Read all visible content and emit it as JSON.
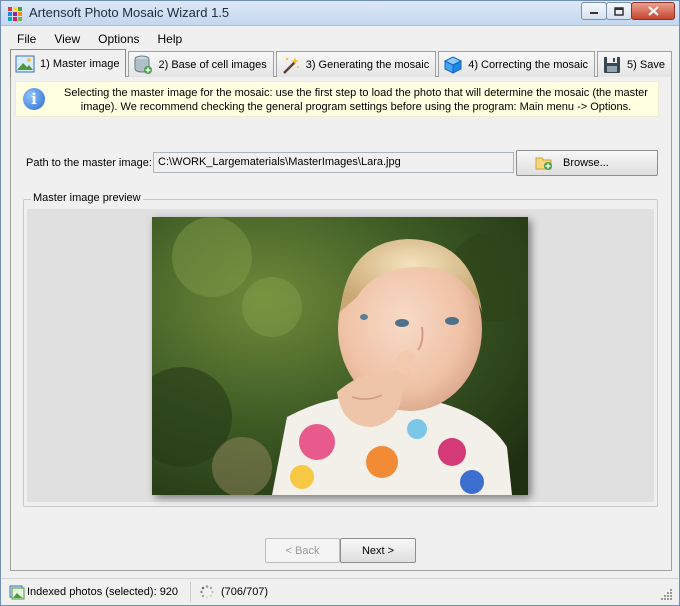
{
  "window": {
    "title": "Artensoft Photo Mosaic Wizard 1.5",
    "controls": {
      "minimize": "minimize",
      "maximize": "maximize",
      "close": "close"
    }
  },
  "menu": [
    "File",
    "View",
    "Options",
    "Help"
  ],
  "tabs": [
    {
      "label": "1) Master image",
      "icon": "image-icon",
      "active": true
    },
    {
      "label": "2) Base of cell images",
      "icon": "database-add-icon",
      "active": false
    },
    {
      "label": "3) Generating the mosaic",
      "icon": "magic-wand-icon",
      "active": false
    },
    {
      "label": "4) Correcting the mosaic",
      "icon": "cube-icon",
      "active": false
    },
    {
      "label": "5) Save",
      "icon": "floppy-disk-icon",
      "active": false
    }
  ],
  "info": {
    "line1": "Selecting the master image for the mosaic: use the first step to load the photo that will determine the mosaic (the master",
    "line2": "image). We recommend checking the general program settings before using the program: Main menu -> Options."
  },
  "path": {
    "label": "Path to the master image:",
    "value": "C:\\WORK_Largematerials\\MasterImages\\Lara.jpg",
    "browse_label": "Browse..."
  },
  "preview": {
    "legend": "Master image preview"
  },
  "nav": {
    "back_label": "< Back",
    "next_label": "Next >"
  },
  "status": {
    "photos": "Indexed photos (selected): 920",
    "progress": "(706/707)"
  },
  "colors": {
    "accent": "#2b69c9",
    "info_bg": "#ffffe1",
    "close_button": "#c6452d"
  }
}
